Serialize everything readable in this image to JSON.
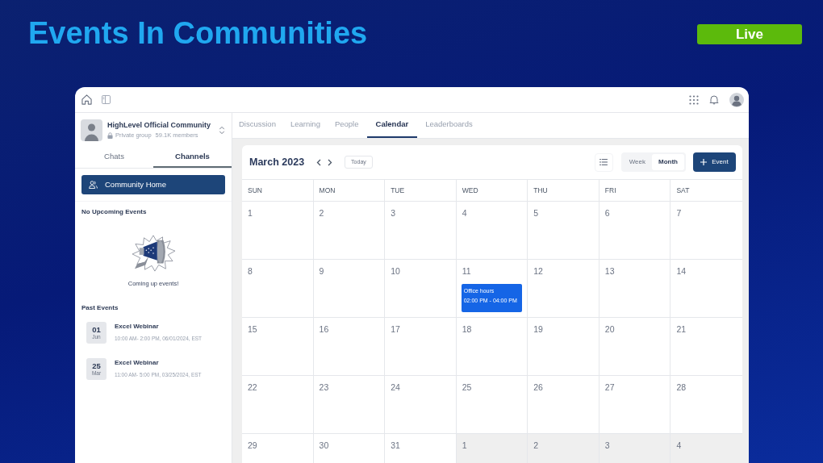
{
  "header": {
    "title": "Events In Communities",
    "badge": "Live"
  },
  "sidebar": {
    "community": {
      "name": "HighLevel Official Community",
      "privacy": "Private group",
      "members": "59.1K members"
    },
    "tabs": [
      {
        "label": "Chats",
        "selected": false
      },
      {
        "label": "Channels",
        "selected": true
      }
    ],
    "channels": [
      {
        "label": "Community Home",
        "selected": true
      }
    ],
    "upcoming": {
      "title": "No Upcoming Events",
      "empty_text": "Coming up events!"
    },
    "past_events": {
      "title": "Past Events",
      "items": [
        {
          "day": "01",
          "month": "Jun",
          "title": "Excel Webinar",
          "time": "10:00 AM- 2:00 PM, 06/01/2024, EST"
        },
        {
          "day": "25",
          "month": "Mar",
          "title": "Excel Webinar",
          "time": "11:00 AM- 5:00 PM, 03/25/2024, EST"
        }
      ]
    }
  },
  "nav_tabs": [
    {
      "label": "Discussion",
      "selected": false
    },
    {
      "label": "Learning",
      "selected": false
    },
    {
      "label": "People",
      "selected": false
    },
    {
      "label": "Calendar",
      "selected": true
    },
    {
      "label": "Leaderboards",
      "selected": false
    }
  ],
  "calendar": {
    "month": "March 2023",
    "today_button": {
      "label": "Today",
      "disabled": true
    },
    "views": [
      {
        "label": "Week",
        "selected": false
      },
      {
        "label": "Month",
        "selected": true
      }
    ],
    "add_button": "Event",
    "weekdays": [
      "SUN",
      "MON",
      "TUE",
      "WED",
      "THU",
      "FRI",
      "SAT"
    ],
    "weeks": [
      {
        "days": [
          {
            "date": "1",
            "in_month": true
          },
          {
            "date": "2",
            "in_month": true
          },
          {
            "date": "3",
            "in_month": true
          },
          {
            "date": "4",
            "in_month": true
          },
          {
            "date": "5",
            "in_month": true
          },
          {
            "date": "6",
            "in_month": true
          },
          {
            "date": "7",
            "in_month": true
          }
        ]
      },
      {
        "days": [
          {
            "date": "8",
            "in_month": true
          },
          {
            "date": "9",
            "in_month": true
          },
          {
            "date": "10",
            "in_month": true
          },
          {
            "date": "11",
            "in_month": true,
            "events": [
              {
                "title": "Office hours",
                "time": "02:00 PM - 04:00 PM"
              }
            ]
          },
          {
            "date": "12",
            "in_month": true
          },
          {
            "date": "13",
            "in_month": true
          },
          {
            "date": "14",
            "in_month": true
          }
        ]
      },
      {
        "days": [
          {
            "date": "15",
            "in_month": true
          },
          {
            "date": "16",
            "in_month": true
          },
          {
            "date": "17",
            "in_month": true
          },
          {
            "date": "18",
            "in_month": true
          },
          {
            "date": "19",
            "in_month": true
          },
          {
            "date": "20",
            "in_month": true
          },
          {
            "date": "21",
            "in_month": true
          }
        ]
      },
      {
        "days": [
          {
            "date": "22",
            "in_month": true
          },
          {
            "date": "23",
            "in_month": true
          },
          {
            "date": "24",
            "in_month": true
          },
          {
            "date": "25",
            "in_month": true
          },
          {
            "date": "26",
            "in_month": true
          },
          {
            "date": "27",
            "in_month": true
          },
          {
            "date": "28",
            "in_month": true
          }
        ]
      },
      {
        "days": [
          {
            "date": "29",
            "in_month": true
          },
          {
            "date": "30",
            "in_month": true
          },
          {
            "date": "31",
            "in_month": true
          },
          {
            "date": "1",
            "in_month": false
          },
          {
            "date": "2",
            "in_month": false
          },
          {
            "date": "3",
            "in_month": false
          },
          {
            "date": "4",
            "in_month": false
          }
        ]
      }
    ]
  }
}
